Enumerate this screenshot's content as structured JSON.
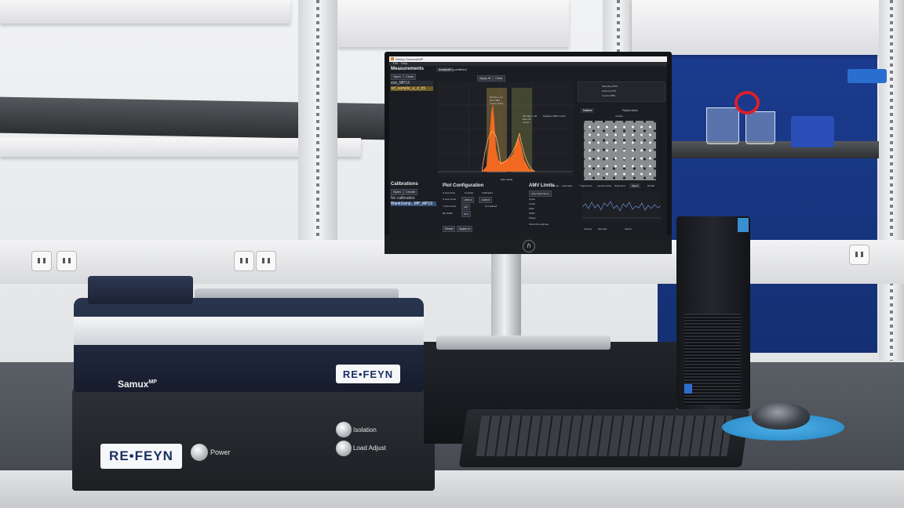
{
  "instrument": {
    "model": "Samux",
    "model_superscript": "MP",
    "brand_logo_text": "RE•FEYN",
    "power_label": "Power",
    "isolation_label": "Isolation",
    "load_adjust_label": "Load Adjust"
  },
  "monitor_software": {
    "window_title": "Refeyn DiscoverMP",
    "menu": [
      "File",
      "Help"
    ],
    "measurements_heading": "Measurements",
    "measurement_buttons": [
      "Open",
      "Close"
    ],
    "measurement_items": [
      "eve_MP13",
      "ref_sample_a_d_h5"
    ],
    "top_tabs": [
      "Analysis",
      "Figures",
      "Batch"
    ],
    "toolbar_buttons": [
      "Apply fit",
      "Clear"
    ],
    "histogram": {
      "xlabel": "Mass [kDa]",
      "peak_annotations": [
        "99 kDa σ 10 kDa 1580 counts (43%)",
        "481 kDa σ 38 kDa 7% counts"
      ],
      "summary": "Displays 3380 counts"
    },
    "calibrations_heading": "Calibrations",
    "calibration_buttons": [
      "Open",
      "Create"
    ],
    "calibration_items": [
      "No calibration",
      "BlankSamp...MP_MP13"
    ],
    "plot_configuration": {
      "heading": "Plot Configuration",
      "axis_units_label": "X Axis Units",
      "axis_units_options": [
        "Contrast",
        "Calibrated"
      ],
      "x_axis_limits_label": "X Axis Limits",
      "y_axis_limits_label": "Y Axis Limits",
      "normalized_label": "Normalized",
      "bin_width_label": "Bin Width",
      "x_limits": [
        "-2584.9",
        "-9,983.8"
      ],
      "y_limit": "150",
      "bin_width": "20.1",
      "buttons": [
        "Reset",
        "Apply to"
      ]
    },
    "amu_limits": {
      "heading": "AMV Limits",
      "mode_options": [
        "Manual",
        "Automatic"
      ],
      "auto_button": "Auto Parameters",
      "row_labels": [
        "Upper",
        "Lower",
        "Ratio",
        "Width",
        "Phase"
      ],
      "footer": "Show this estimate"
    },
    "right_panel": {
      "stats": [
        "Sampling 4870",
        "Frames 1678",
        "Counts 3580"
      ],
      "view_tabs": [
        "Native",
        "Ratiometric"
      ],
      "image_caption": "sample",
      "lower_tabs": [
        "Trajectories",
        "Landing rates",
        "Brightness",
        "Signal",
        "Mindiff"
      ],
      "footer": [
        "Frames",
        "Seconds",
        "Speed"
      ]
    }
  },
  "colors": {
    "histogram_fill": "#f26a21",
    "accent_orange": "#e0a03a",
    "app_background": "#1b1d22",
    "cabinet_blue": "#1b3b8f",
    "mousepad_blue": "#3a9fdc"
  },
  "icons": [
    "hp-logo",
    "socket-icon",
    "power-knob",
    "isolation-knob",
    "load-adjust-knob"
  ]
}
